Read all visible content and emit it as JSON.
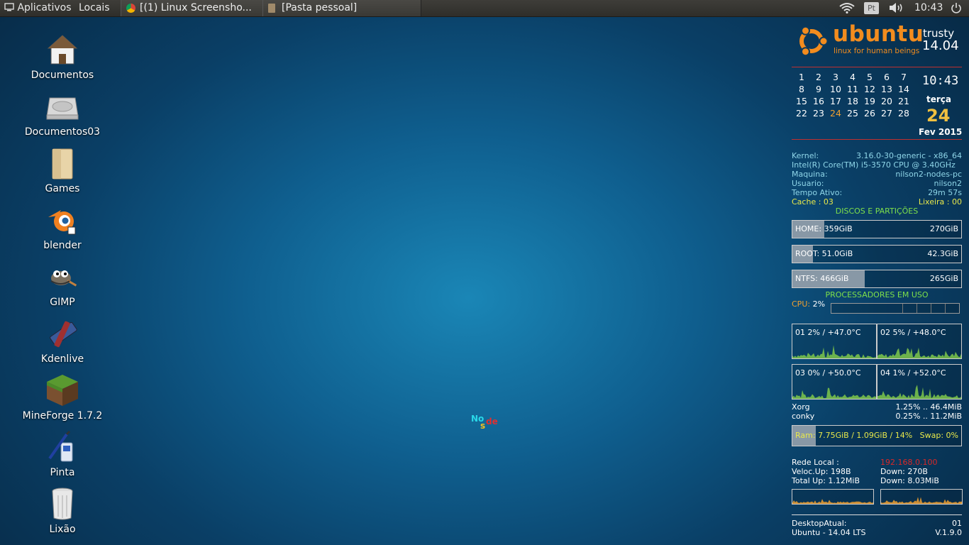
{
  "panel": {
    "apps_label": "Aplicativos",
    "places_label": "Locais",
    "tasks": [
      {
        "label": "[(1) Linux Screensho..."
      },
      {
        "label": "[Pasta pessoal]"
      }
    ],
    "keyboard_layout": "Pt",
    "time": "10:43"
  },
  "desktop_icons": [
    {
      "label": "Documentos",
      "icon": "home-folder-icon"
    },
    {
      "label": "Documentos03",
      "icon": "hard-drive-icon"
    },
    {
      "label": "Games",
      "icon": "folder-icon"
    },
    {
      "label": "blender",
      "icon": "blender-icon"
    },
    {
      "label": "GIMP",
      "icon": "gimp-icon"
    },
    {
      "label": "Kdenlive",
      "icon": "kdenlive-icon"
    },
    {
      "label": "MineForge 1.7.2",
      "icon": "minecraft-block-icon"
    },
    {
      "label": "Pinta",
      "icon": "pinta-brush-icon"
    },
    {
      "label": "Lixão",
      "icon": "trash-icon"
    }
  ],
  "center_logo": {
    "part1": "No",
    "part2": "s",
    "part3": "de"
  },
  "conky": {
    "logo": {
      "brand": "ubuntu",
      "tagline": "linux for human beings",
      "codename": "trusty",
      "version": "14.04"
    },
    "calendar": {
      "weeks": [
        [
          "1",
          "2",
          "3",
          "4",
          "5",
          "6",
          "7"
        ],
        [
          "8",
          "9",
          "10",
          "11",
          "12",
          "13",
          "14"
        ],
        [
          "15",
          "16",
          "17",
          "18",
          "19",
          "20",
          "21"
        ],
        [
          "22",
          "23",
          "24",
          "25",
          "26",
          "27",
          "28"
        ]
      ],
      "today": "24",
      "clock": "10:43",
      "weekday": "terça",
      "day": "24",
      "month_year": "Fev 2015"
    },
    "sysinfo": [
      {
        "label": "Kernel:",
        "value": "3.16.0-30-generic - x86_64"
      },
      {
        "label": "Intel(R) Core(TM) i5-3570 CPU @ 3.40GHz",
        "value": ""
      },
      {
        "label": "Maquina:",
        "value": "nilson2-nodes-pc"
      },
      {
        "label": "Usuario:",
        "value": "nilson2"
      },
      {
        "label": "Tempo Ativo:",
        "value": "29m 57s"
      }
    ],
    "cache": "Cache : 03",
    "trash": "Lixeira : 00",
    "disks_title": "DISCOS E PARTIÇÕES",
    "disks": [
      {
        "label": "HOME: 359GiB",
        "free": "270GiB",
        "used_frac": 0.19
      },
      {
        "label": "ROOT: 51.0GiB",
        "free": "42.3GiB",
        "used_frac": 0.12
      },
      {
        "label": "NTFS: 466GiB",
        "free": "265GiB",
        "used_frac": 0.43
      }
    ],
    "cpu_title": "PROCESSADORES EM USO",
    "cpu_label": "CPU:",
    "cpu_value": "2%",
    "cores": [
      {
        "label": "01 2% / +47.0°C"
      },
      {
        "label": "02 5% / +48.0°C"
      },
      {
        "label": "03 0% / +50.0°C"
      },
      {
        "label": "04 1% / +52.0°C"
      }
    ],
    "processes": [
      {
        "name": "Xorg",
        "value": "1.25% .. 46.4MiB"
      },
      {
        "name": "conky",
        "value": "0.25% .. 11.2MiB"
      }
    ],
    "ram": {
      "label": "Ram:",
      "value": "7.75GiB / 1.09GiB / 14%",
      "swap": "Swap: 0%",
      "used_frac": 0.14
    },
    "network": {
      "local_label": "Rede Local :",
      "ip": "192.168.0.100",
      "up_speed": "Veloc.Up: 198B",
      "down_speed": "Down: 270B",
      "total_up": "Total Up: 1.12MiB",
      "total_down": "Down: 8.03MiB"
    },
    "footer": {
      "desktop_label": "DesktopAtual:",
      "desktop_value": "01",
      "distro": "Ubuntu - 14.04 LTS",
      "version": "V.1.9.0"
    }
  },
  "colors": {
    "ubuntu_orange": "#f28c1e",
    "conky_cyan": "#8fd6e8",
    "conky_yellow": "#e8e84a",
    "conky_green": "#7ee04a",
    "ip_red": "#d82828",
    "graph_green": "#7ec84a",
    "graph_orange": "#f0a030"
  }
}
